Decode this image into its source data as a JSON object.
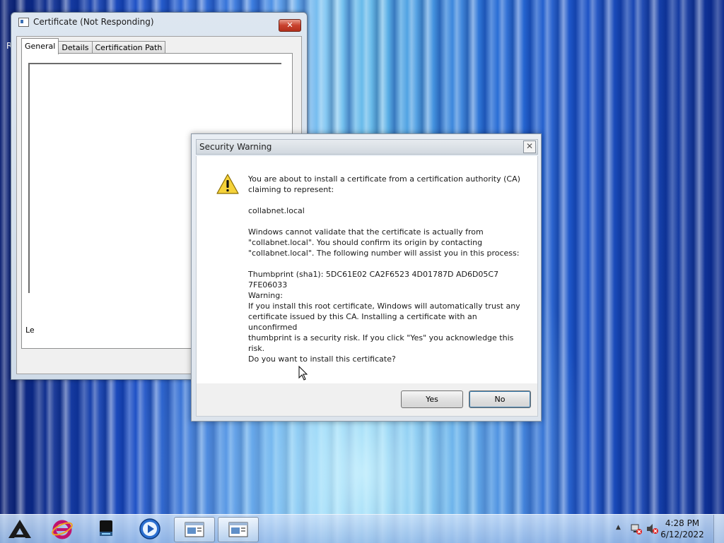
{
  "desktop": {
    "label": "R"
  },
  "cert_window": {
    "title": "Certificate (Not Responding)",
    "close_label": "✕",
    "tabs": [
      {
        "label": "General",
        "active": true
      },
      {
        "label": "Details",
        "active": false
      },
      {
        "label": "Certification Path",
        "active": false
      }
    ],
    "partial_label": "Le"
  },
  "security_dialog": {
    "title": "Security Warning",
    "close_label": "✕",
    "intro": "You are about to install a certificate from a certification authority (CA)\nclaiming to represent:",
    "subject": "collabnet.local",
    "validation": "Windows cannot validate that the certificate is actually from\n\"collabnet.local\". You should confirm its origin by contacting\n\"collabnet.local\". The following number will assist you in this process:",
    "thumbprint": "Thumbprint (sha1): 5DC61E02 CA2F6523 4D01787D AD6D05C7 7FE06033",
    "warning": "Warning:\nIf you install this root certificate, Windows will automatically trust any\ncertificate issued by this CA. Installing a certificate with an unconfirmed\nthumbprint is a security risk. If you click \"Yes\" you acknowledge this\nrisk.",
    "question": "Do you want to install this certificate?",
    "yes_label": "Yes",
    "no_label": "No"
  },
  "taskbar": {
    "pinned": [
      "app-logo-icon",
      "internet-explorer-icon",
      "drive-icon",
      "media-player-icon"
    ],
    "windows": [
      "certificate-window",
      "security-warning-window"
    ],
    "clock_time": "4:28 PM",
    "clock_date": "6/12/2022",
    "tray_arrow": "▲"
  }
}
